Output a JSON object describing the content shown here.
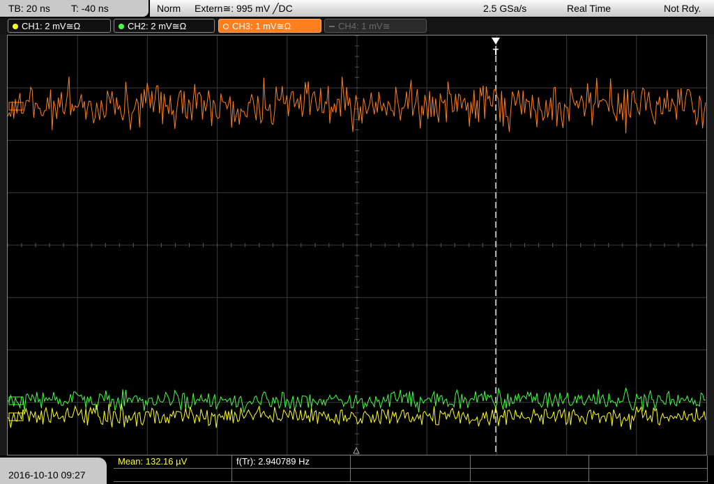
{
  "topbar": {
    "timebase": "TB: 20 ns",
    "trigger_offset": "T: -40 ns",
    "mode": "Norm",
    "trigger_source": "Extern≅: 995 mV ╱DC",
    "sample_rate": "2.5 GSa/s",
    "acquisition": "Real Time",
    "status": "Not Rdy."
  },
  "channels": [
    {
      "label": "CH1: 2 mV≅Ω",
      "color": "#ffff20",
      "active": true
    },
    {
      "label": "CH2: 2 mV≅Ω",
      "color": "#44ff44",
      "active": true
    },
    {
      "label": "CH3: 1 mV≅Ω",
      "color": "#ff7f1e",
      "active": true,
      "selected": true
    },
    {
      "label": "CH4: 1 mV≅",
      "color": "#6a6a6a",
      "active": false
    }
  ],
  "screen": {
    "trigger_marker": "T",
    "traces": {
      "ch3_color": "#ff7f1e",
      "ch2_color": "#44ff44",
      "ch1_color": "#ffff20"
    }
  },
  "bottombar": {
    "datetime": "2016-10-10 09:27",
    "mean": "Mean: 132.16 µV",
    "frequency": "f(Tr): 2.940789 Hz"
  }
}
